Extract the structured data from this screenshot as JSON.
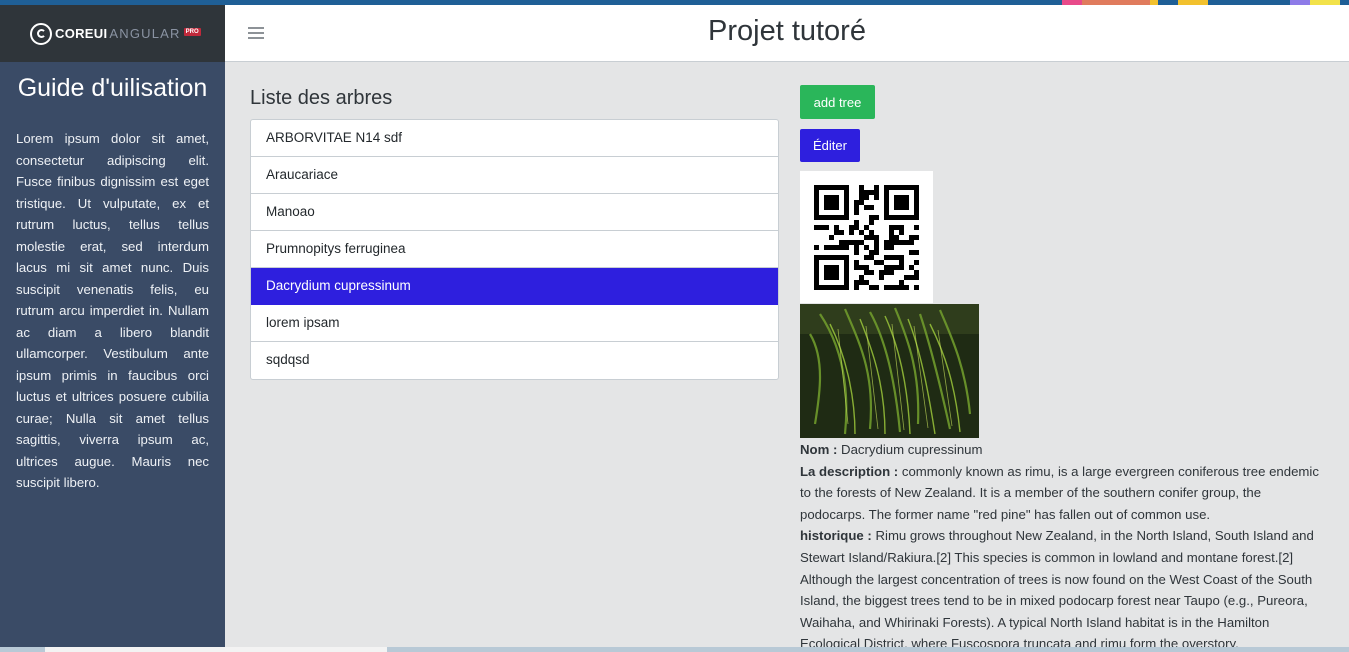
{
  "brand": {
    "word1": "COREUI",
    "word2": "ANGULAR",
    "badge": "PRO",
    "logo_icon": "coreui-logo-icon"
  },
  "header": {
    "title": "Projet tutoré",
    "toggler_icon": "hamburger-menu-icon"
  },
  "sidebar": {
    "title": "Guide d'uilisation",
    "text": "Lorem ipsum dolor sit amet, consectetur adipiscing elit. Fusce finibus dignissim est eget tristique. Ut vulputate, ex et rutrum luctus, tellus tellus molestie erat, sed interdum lacus mi sit amet nunc. Duis suscipit venenatis felis, eu rutrum arcu imperdiet in. Nullam ac diam a libero blandit ullamcorper. Vestibulum ante ipsum primis in faucibus orci luctus et ultrices posuere cubilia curae; Nulla sit amet tellus sagittis, viverra ipsum ac, ultrices augue. Mauris nec suscipit libero."
  },
  "trees": {
    "title": "Liste des arbres",
    "items": [
      "ARBORVITAE N14 sdf",
      "Araucariace",
      "Manoao",
      "Prumnopitys ferruginea",
      "Dacrydium cupressinum",
      "lorem ipsam",
      "sqdqsd"
    ],
    "active_index": 4
  },
  "actions": {
    "add_label": "add tree",
    "edit_label": "Éditer"
  },
  "detail": {
    "name_label": "Nom :",
    "name_value": "Dacrydium cupressinum",
    "description_label": "La description :",
    "description_value": "commonly known as rimu, is a large evergreen coniferous tree endemic to the forests of New Zealand. It is a member of the southern conifer group, the podocarps. The former name \"red pine\" has fallen out of common use.",
    "history_label": "historique :",
    "history_value": "Rimu grows throughout New Zealand, in the North Island, South Island and Stewart Island/Rakiura.[2] This species is common in lowland and montane forest.[2] Although the largest concentration of trees is now found on the West Coast of the South Island, the biggest trees tend to be in mixed podocarp forest near Taupo (e.g., Pureora, Waihaha, and Whirinaki Forests). A typical North Island habitat is in the Hamilton Ecological District, where Fuscospora truncata and rimu form the overstory."
  },
  "colors": {
    "sidebar_bg": "#3a4b66",
    "brand_bg": "#2f353a",
    "active_item": "#2e1fde",
    "add_button": "#2ab65a",
    "edit_button": "#2e1fde"
  }
}
